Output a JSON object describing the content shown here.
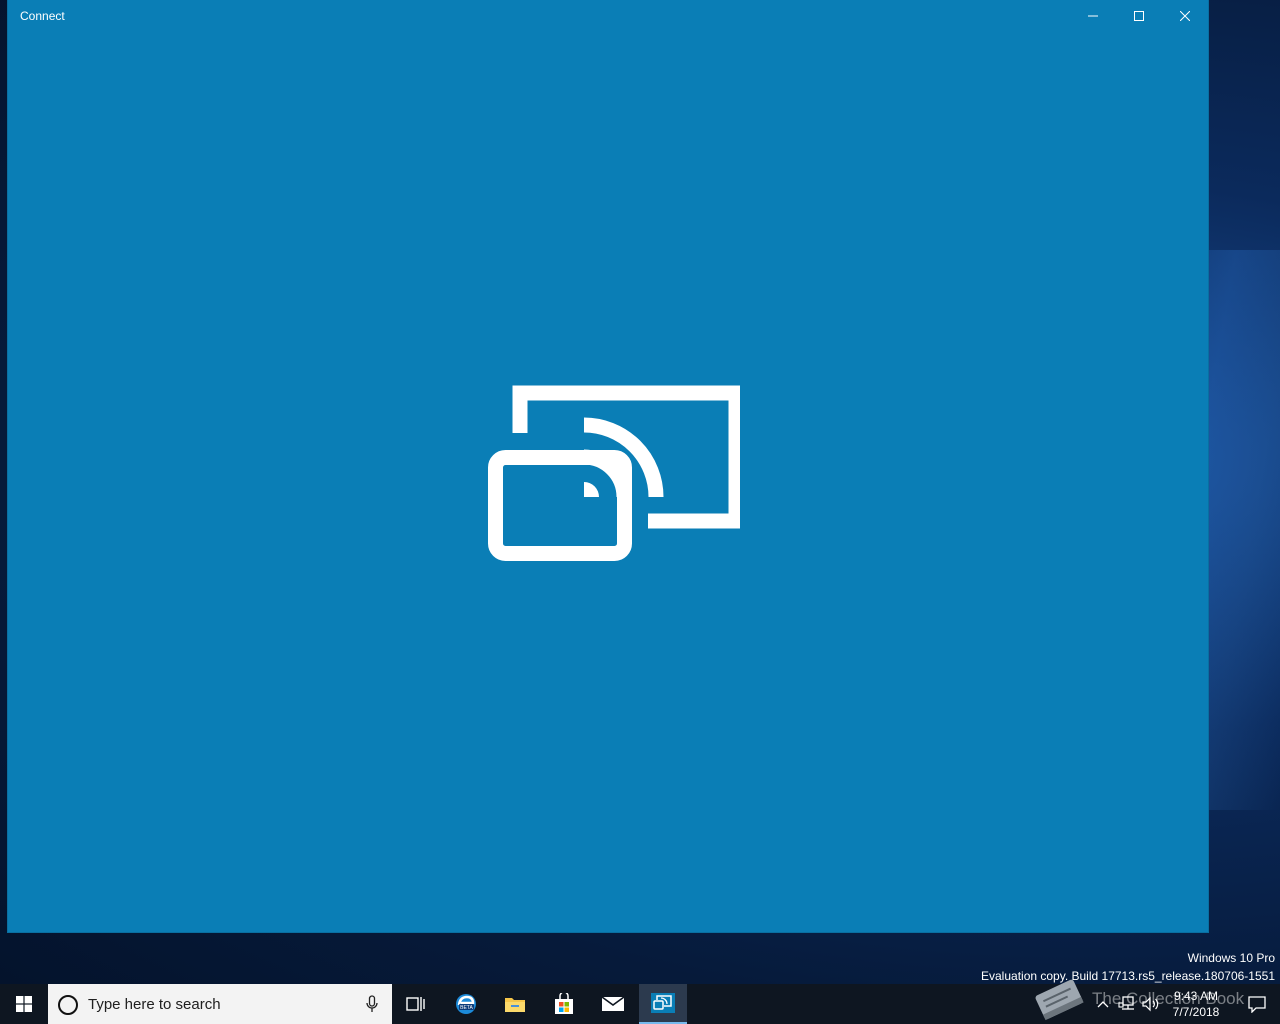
{
  "window": {
    "title": "Connect",
    "background": "#0a7eb6",
    "controls": [
      "minimize-icon",
      "maximize-icon",
      "close-icon"
    ],
    "center_icon": "project-to-screen-icon"
  },
  "watermark": {
    "line1": "Windows 10 Pro",
    "line2": "Evaluation copy. Build 17713.rs5_release.180706-1551"
  },
  "taskbar": {
    "search_placeholder": "Type here to search",
    "apps": [
      "task-view-icon",
      "edge-beta-icon",
      "file-explorer-icon",
      "store-icon",
      "mail-icon",
      "connect-app-icon"
    ],
    "active_app": "connect-app-icon",
    "overlay_text": "The Collection Book",
    "clock": {
      "time": "9:43 AM",
      "date": "7/7/2018"
    }
  }
}
